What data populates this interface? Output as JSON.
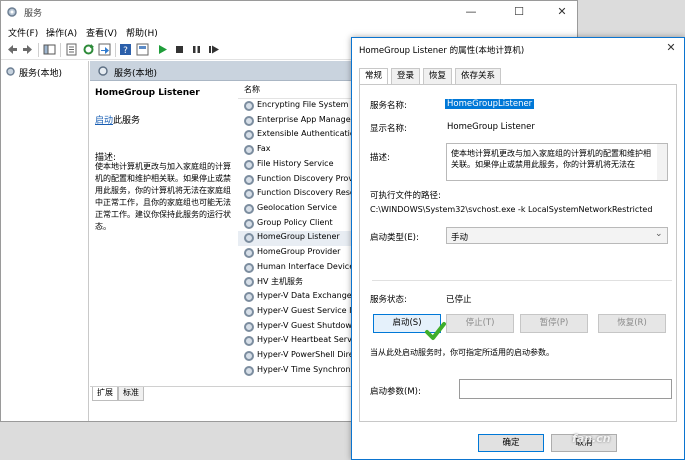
{
  "main_window": {
    "title": "服务",
    "menu": [
      "文件(F)",
      "操作(A)",
      "查看(V)",
      "帮助(H)"
    ],
    "minimize": "—",
    "maximize": "☐",
    "close": "✕"
  },
  "tree": {
    "root_label": "服务(本地)"
  },
  "services_pane": {
    "header": "服务(本地)",
    "selected_title": "HomeGroup Listener",
    "start_link": "启动",
    "start_suffix": "此服务",
    "description_label": "描述:",
    "description_text": "使本地计算机更改与加入家庭组的计算机的配置和维护相关联。如果停止或禁用此服务，你的计算机将无法在家庭组中正常工作，且你的家庭组也可能无法正常工作。建议你保持此服务的运行状态。",
    "column_name": "名称",
    "rows": [
      "Encrypting File System (",
      "Enterprise App Manage",
      "Extensible Authenticatio",
      "Fax",
      "File History Service",
      "Function Discovery Prov",
      "Function Discovery Reso",
      "Geolocation Service",
      "Group Policy Client",
      "HomeGroup Listener",
      "HomeGroup Provider",
      "Human Interface Device",
      "HV 主机服务",
      "Hyper-V Data Exchange",
      "Hyper-V Guest Service I",
      "Hyper-V Guest Shutdow",
      "Hyper-V Heartbeat Serv",
      "Hyper-V PowerShell Dire",
      "Hyper-V Time Synchron"
    ],
    "selected_row": "HomeGroup Listener",
    "bottom_tabs": [
      "扩展",
      "标准"
    ]
  },
  "dialog": {
    "title": "HomeGroup Listener 的属性(本地计算机)",
    "close": "✕",
    "tabs": [
      "常规",
      "登录",
      "恢复",
      "依存关系"
    ],
    "active_tab": "常规",
    "service_name_label": "服务名称:",
    "service_name_value": "HomeGroupListener",
    "display_name_label": "显示名称:",
    "display_name_value": "HomeGroup Listener",
    "description_label": "描述:",
    "description_value": "使本地计算机更改与加入家庭组的计算机的配置和维护相关联。如果停止或禁用此服务，你的计算机将无法在",
    "exec_path_label": "可执行文件的路径:",
    "exec_path_value": "C:\\WINDOWS\\System32\\svchost.exe -k LocalSystemNetworkRestricted",
    "startup_type_label": "启动类型(E):",
    "startup_type_value": "手动",
    "service_status_label": "服务状态:",
    "service_status_value": "已停止",
    "buttons": {
      "start": "启动(S)",
      "stop": "停止(T)",
      "pause": "暂停(P)",
      "resume": "恢复(R)"
    },
    "hint": "当从此处启动服务时，你可指定所适用的启动参数。",
    "start_params_label": "启动参数(M):",
    "start_params_value": "",
    "ok": "确定",
    "cancel": "取消"
  },
  "watermark": "fan.cn",
  "colors": {
    "accent": "#0078d7",
    "checkmark": "#3fae2a",
    "pane_header": "#c9d3de"
  }
}
